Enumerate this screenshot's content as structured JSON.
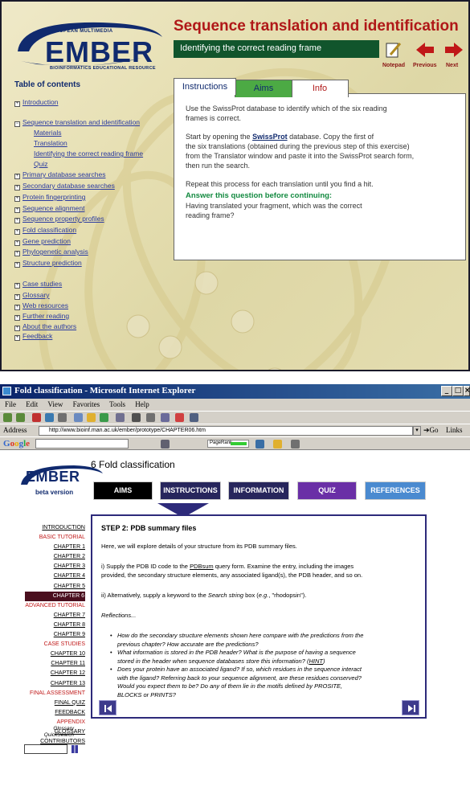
{
  "ember_panel": {
    "logo_small": "EUROPEAN MULTIMEDIA",
    "logo_big": "EMBER",
    "logo_sub": "BIOINFORMATICS EDUCATIONAL RESOURCE",
    "title": "Sequence translation and identification",
    "subtitle": "Identifying the correct reading frame",
    "nav": {
      "notepad": "Notepad",
      "previous": "Previous",
      "next": "Next"
    },
    "toc_title": "Table of contents",
    "toc": [
      "Introduction",
      "Sequence translation and identification",
      "Materials",
      "Translation",
      "Identifying the correct reading frame",
      "Quiz",
      "Primary database searches",
      "Secondary database searches",
      "Protein fingerprinting",
      "Sequence alignment",
      "Sequence property profiles",
      "Fold classification",
      "Gene prediction",
      "Phylogenetic analysis",
      "Structure prediction",
      "Case studies",
      "Glossary",
      "Web resources",
      "Further reading",
      "About the authors",
      "Feedback"
    ],
    "tabs": {
      "instructions": "Instructions",
      "aims": "Aims",
      "info": "Info"
    },
    "p1a": "Use the SwissProt database to identify which of the six reading",
    "p1b": "frames is correct.",
    "p2a_pre": "Start by opening the ",
    "p2a_link": "SwissProt",
    "p2a_post": " database. Copy the first of",
    "p2b": "the six translations (obtained during the previous step of this exercise)",
    "p2c": "from the Translator window and paste it into the SwissProt search form,",
    "p2d": "then run the search.",
    "p3": "Repeat this process for each translation until you find a hit.",
    "question_heading": "Answer this question before continuing:",
    "q1": "Having translated your fragment, which was the correct",
    "q2": "reading frame?"
  },
  "browser": {
    "window_title": "Fold classification - Microsoft Internet Explorer",
    "menu": [
      "File",
      "Edit",
      "View",
      "Favorites",
      "Tools",
      "Help"
    ],
    "address_label": "Address",
    "address": "http://www.bioinf.man.ac.uk/ember/prototype/CHAPTER06.htm",
    "go": "Go",
    "links": "Links",
    "google": "Google",
    "pagerank": "PageRank"
  },
  "page": {
    "logo": "EMBER",
    "beta": "beta version",
    "title": "6 Fold classification",
    "buttons": {
      "aims": "AIMS",
      "instructions": "INSTRUCTIONS",
      "information": "INFORMATION",
      "quiz": "QUIZ",
      "references": "REFERENCES"
    },
    "sidebar": {
      "introduction": "INTRODUCTION",
      "basic": "BASIC TUTORIAL",
      "ch1": "CHAPTER 1",
      "ch2": "CHAPTER 2",
      "ch3": "CHAPTER 3",
      "ch4": "CHAPTER 4",
      "ch5": "CHAPTER 5",
      "ch6": "CHAPTER 6",
      "advanced": "ADVANCED TUTORIAL",
      "ch7": "CHAPTER 7",
      "ch8": "CHAPTER 8",
      "ch9": "CHAPTER 9",
      "case": "CASE STUDIES",
      "ch10": "CHAPTER 10",
      "ch11": "CHAPTER 11",
      "ch12": "CHAPTER 12",
      "ch13": "CHAPTER 13",
      "final": "FINAL ASSESSMENT",
      "final_quiz": "FINAL QUIZ",
      "feedback": "FEEDBACK",
      "appendix": "APPENDIX",
      "glossary": "GLOSSARY",
      "contributors": "CONTRIBUTORS",
      "glossary_qs1": "Glossary",
      "glossary_qs2": "QuickSearch"
    },
    "step_title": "STEP 2: PDB summary files",
    "intro": "Here, we will explore details of your structure from its PDB summary files.",
    "i_line1_pre": "i) Supply the PDB ID code to the ",
    "i_line1_link": "PDBsum",
    "i_line1_post": " query form. Examine the entry, including the images",
    "i_line2": "provided, the secondary structure elements, any associated ligand(s), the PDB header, and so on.",
    "ii_pre": "ii) Alternatively, supply a keyword to the ",
    "ii_italic": "Search string",
    "ii_mid": " box (",
    "ii_eg": "e.g.",
    "ii_post": ", \"rhodopsin\").",
    "reflections": "Reflections...",
    "bullet1a": "How do the secondary structure elements shown here compare with the predictions from the",
    "bullet1b": "previous chapter? How accurate are the predictions?",
    "bullet2a": "What information is stored in the PDB header? What is the purpose of having a sequence",
    "bullet2b_pre": "stored in the header when sequence databases store this information? (",
    "bullet2b_link": "HINT",
    "bullet2b_post": ")",
    "bullet3a": "Does your protein have an associated ligand? If so, which residues in the sequence interact",
    "bullet3b": "with the ligand? Referring back to your sequence alignment, are these residues conserved?",
    "bullet3c": "Would you expect them to be? Do any of them lie in the motifs defined by PROSITE,",
    "bullet3d": "BLOCKS or PRINTS?"
  },
  "colors": {
    "ember_blue": "#102a6e",
    "title_red": "#b01818",
    "bar_green": "#11552c",
    "nav_purple": "#2d2a7a"
  }
}
